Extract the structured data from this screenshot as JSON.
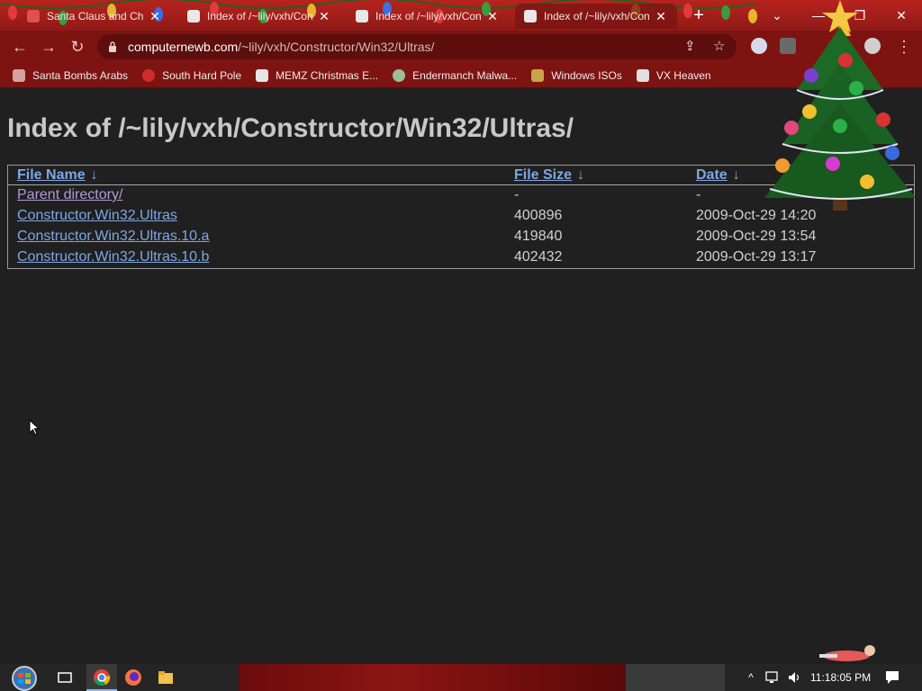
{
  "browser": {
    "tabs": [
      {
        "title": "Santa Claus and Christ",
        "icon": "santa-icon",
        "active": false
      },
      {
        "title": "Index of /~lily/vxh/Con",
        "icon": "vx-heaven-icon",
        "active": false
      },
      {
        "title": "Index of /~lily/vxh/Con",
        "icon": "vx-heaven-icon",
        "active": false
      },
      {
        "title": "Index of /~lily/vxh/Con",
        "icon": "vx-heaven-icon",
        "active": true
      }
    ],
    "url_host": "computernewb.com",
    "url_path": "/~lily/vxh/Constructor/Win32/Ultras/",
    "bookmarks": [
      {
        "label": "Santa Bombs Arabs",
        "icon": "santa-icon"
      },
      {
        "label": "South Hard Pole",
        "icon": "snowflake-icon"
      },
      {
        "label": "MEMZ Christmas E...",
        "icon": "memz-icon"
      },
      {
        "label": "Endermanch Malwa...",
        "icon": "endermanch-icon"
      },
      {
        "label": "Windows ISOs",
        "icon": "windows-isos-icon"
      },
      {
        "label": "VX Heaven",
        "icon": "vx-heaven-icon"
      }
    ],
    "accent_color": "#8f1a17"
  },
  "page": {
    "heading": "Index of /~lily/vxh/Constructor/Win32/Ultras/",
    "columns": {
      "name": "File Name",
      "size": "File Size",
      "date": "Date",
      "sort_arrow": "↓"
    },
    "rows": [
      {
        "name": "Parent directory/",
        "size": "-",
        "date": "-"
      },
      {
        "name": "Constructor.Win32.Ultras",
        "size": "400896",
        "date": "2009-Oct-29 14:20"
      },
      {
        "name": "Constructor.Win32.Ultras.10.a",
        "size": "419840",
        "date": "2009-Oct-29 13:54"
      },
      {
        "name": "Constructor.Win32.Ultras.10.b",
        "size": "402432",
        "date": "2009-Oct-29 13:17"
      }
    ]
  },
  "taskbar": {
    "clock": "11:18:05 PM"
  }
}
